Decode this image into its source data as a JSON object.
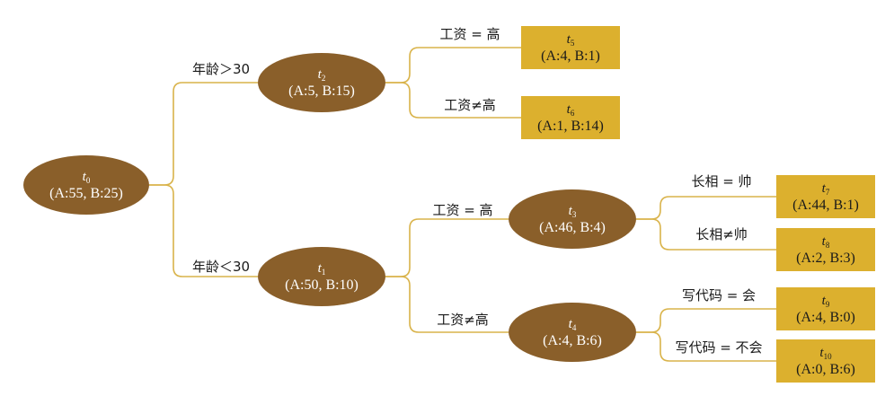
{
  "colors": {
    "internal_fill": "#8a5f2a",
    "internal_text": "#ffffff",
    "leaf_fill": "#dcb02e",
    "leaf_text": "#1a1a1a",
    "link": "#d9b34a"
  },
  "nodes": [
    {
      "id": "t0",
      "label": "t",
      "sub": "0",
      "counts": "(A:55, B:25)",
      "kind": "internal"
    },
    {
      "id": "t2",
      "label": "t",
      "sub": "2",
      "counts": "(A:5, B:15)",
      "kind": "internal"
    },
    {
      "id": "t1",
      "label": "t",
      "sub": "1",
      "counts": "(A:50, B:10)",
      "kind": "internal"
    },
    {
      "id": "t3",
      "label": "t",
      "sub": "3",
      "counts": "(A:46, B:4)",
      "kind": "internal"
    },
    {
      "id": "t4",
      "label": "t",
      "sub": "4",
      "counts": "(A:4, B:6)",
      "kind": "internal"
    },
    {
      "id": "t5",
      "label": "t",
      "sub": "5",
      "counts": "(A:4, B:1)",
      "kind": "leaf"
    },
    {
      "id": "t6",
      "label": "t",
      "sub": "6",
      "counts": "(A:1, B:14)",
      "kind": "leaf"
    },
    {
      "id": "t7",
      "label": "t",
      "sub": "7",
      "counts": "(A:44, B:1)",
      "kind": "leaf"
    },
    {
      "id": "t8",
      "label": "t",
      "sub": "8",
      "counts": "(A:2, B:3)",
      "kind": "leaf"
    },
    {
      "id": "t9",
      "label": "t",
      "sub": "9",
      "counts": "(A:4, B:0)",
      "kind": "leaf"
    },
    {
      "id": "t10",
      "label": "t",
      "sub": "10",
      "counts": "(A:0, B:6)",
      "kind": "leaf"
    }
  ],
  "edges": [
    {
      "from": "t0",
      "to": "t2",
      "label": "年龄＞30"
    },
    {
      "from": "t0",
      "to": "t1",
      "label": "年龄＜30"
    },
    {
      "from": "t2",
      "to": "t5",
      "label": "工资 = 高"
    },
    {
      "from": "t2",
      "to": "t6",
      "label": "工资≠高"
    },
    {
      "from": "t1",
      "to": "t3",
      "label": "工资 = 高"
    },
    {
      "from": "t1",
      "to": "t4",
      "label": "工资≠高"
    },
    {
      "from": "t3",
      "to": "t7",
      "label": "长相 = 帅"
    },
    {
      "from": "t3",
      "to": "t8",
      "label": "长相≠帅"
    },
    {
      "from": "t4",
      "to": "t9",
      "label": "写代码 = 会"
    },
    {
      "from": "t4",
      "to": "t10",
      "label": "写代码 = 不会"
    }
  ]
}
